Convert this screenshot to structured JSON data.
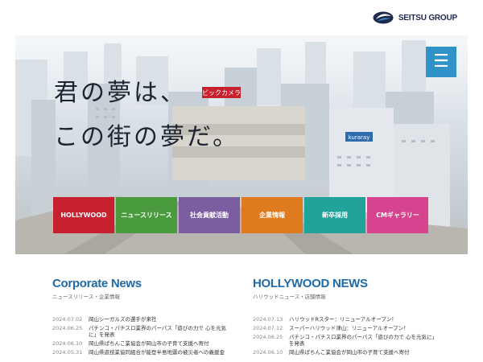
{
  "header": {
    "logo_text": "SEITSU GROUP",
    "brand_color": "#1d2a4d"
  },
  "hero": {
    "copy_line1": "君の夢は、",
    "copy_line2": "この街の夢だ。",
    "menu_icon": "☰",
    "signs": {
      "bic": "ビックカメラ",
      "kuraray": "kuraray"
    }
  },
  "nav": [
    {
      "label": "HOLLYWOOD",
      "color": "#c8202f"
    },
    {
      "label": "ニュースリリース",
      "color": "#4a9a3e"
    },
    {
      "label": "社会貢献活動",
      "color": "#7b5ea0"
    },
    {
      "label": "企業情報",
      "color": "#e07a1e"
    },
    {
      "label": "新卒採用",
      "color": "#22a39a"
    },
    {
      "label": "CMギャラリー",
      "color": "#d5448d"
    }
  ],
  "corporate_news": {
    "title": "Corporate News",
    "subtitle": "ニュースリリース・企業情報",
    "items": [
      {
        "date": "2024.07.02",
        "text": "岡山シーガルズの選手が来社"
      },
      {
        "date": "2024.06.25",
        "text": "パチンコ・パチスロ業界のパーパス「遊びの力で 心を元気に」を発表"
      },
      {
        "date": "2024.06.10",
        "text": "岡山県ぱちんこ業協会が岡山市の子育て支援へ寄付"
      },
      {
        "date": "2024.05.31",
        "text": "岡山県遊技業協同組合が能登半島地震の被災者への義援金"
      }
    ]
  },
  "hollywood_news": {
    "title": "HOLLYWOOD NEWS",
    "subtitle": "ハリウッドニュース・店舗情報",
    "items": [
      {
        "date": "2024.07.13",
        "text": "ハリウッドRスター：リニューアルオープン！"
      },
      {
        "date": "2024.07.12",
        "text": "スーパーハリウッド津山：リニューアルオープン！"
      },
      {
        "date": "2024.06.25",
        "text": "パチンコ・パチスロ業界のパーパス「遊びの力で 心を元気に」を発表"
      },
      {
        "date": "2024.06.10",
        "text": "岡山県ぱちんこ業協会が岡山市の子育て支援へ寄付"
      }
    ]
  }
}
